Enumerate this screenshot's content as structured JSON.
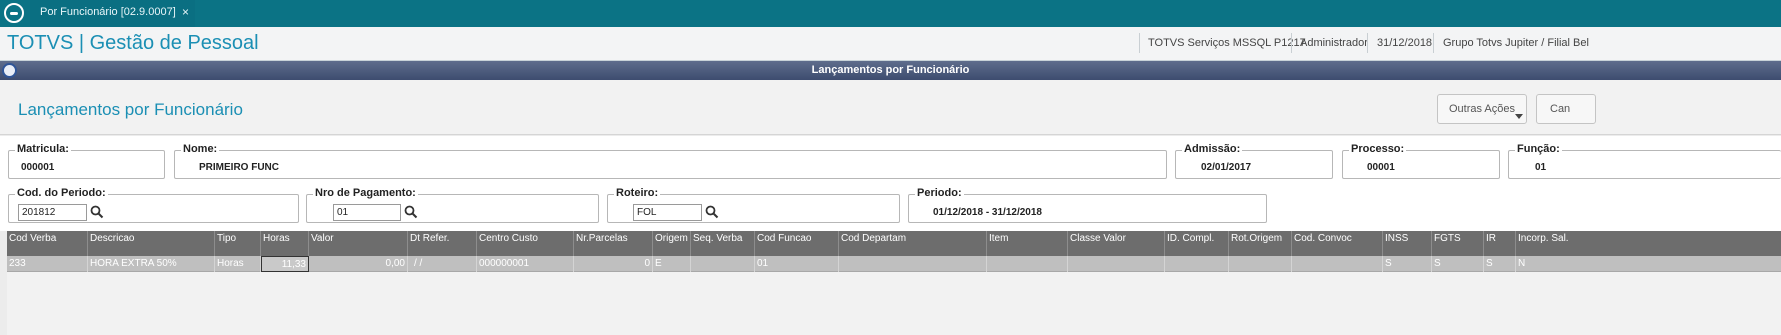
{
  "tab": {
    "title": "Por Funcionário [02.9.0007]",
    "close": "×"
  },
  "app": {
    "title": "TOTVS | Gestão de Pessoal",
    "environment": "TOTVS Serviços MSSQL P1217",
    "user": "Administrador",
    "date": "31/12/2018",
    "branch": "Grupo Totvs Jupiter / Filial Bel"
  },
  "dialog": {
    "title": "Lançamentos por Funcionário"
  },
  "page": {
    "title": "Lançamentos por Funcionário",
    "other_actions": "Outras Ações",
    "cancel": "Can"
  },
  "fields": {
    "matricula": {
      "label": "Matricula:",
      "value": "000001"
    },
    "nome": {
      "label": "Nome:",
      "value": "PRIMEIRO FUNC"
    },
    "admissao": {
      "label": "Admissão:",
      "value": "02/01/2017"
    },
    "processo": {
      "label": "Processo:",
      "value": "00001"
    },
    "funcao": {
      "label": "Função:",
      "value": "01"
    },
    "cod_periodo": {
      "label": "Cod. do Periodo:",
      "value": "201812"
    },
    "nro_pagamento": {
      "label": "Nro de Pagamento:",
      "value": "01"
    },
    "roteiro": {
      "label": "Roteiro:",
      "value": "FOL"
    },
    "periodo": {
      "label": "Periodo:",
      "value": "01/12/2018 - 31/12/2018"
    }
  },
  "grid": {
    "columns": [
      "Cod Verba",
      "Descricao",
      "Tipo",
      "Horas",
      "Valor",
      "Dt Refer.",
      "Centro Custo",
      "Nr.Parcelas",
      "Origem",
      "Seq. Verba",
      "Cod Funcao",
      "Cod Departam",
      "Item",
      "Classe Valor",
      "ID. Compl.",
      "Rot.Origem",
      "Cod. Convoc",
      "INSS",
      "FGTS",
      "IR",
      "Incorp. Sal."
    ],
    "rows": [
      [
        "233",
        "HORA EXTRA 50%",
        "Horas",
        "11,33",
        "0,00",
        " /  /",
        "000000001",
        "0",
        "E",
        "",
        "01",
        "",
        "",
        "",
        "",
        "",
        "",
        "S",
        "S",
        "S",
        "N"
      ]
    ]
  }
}
